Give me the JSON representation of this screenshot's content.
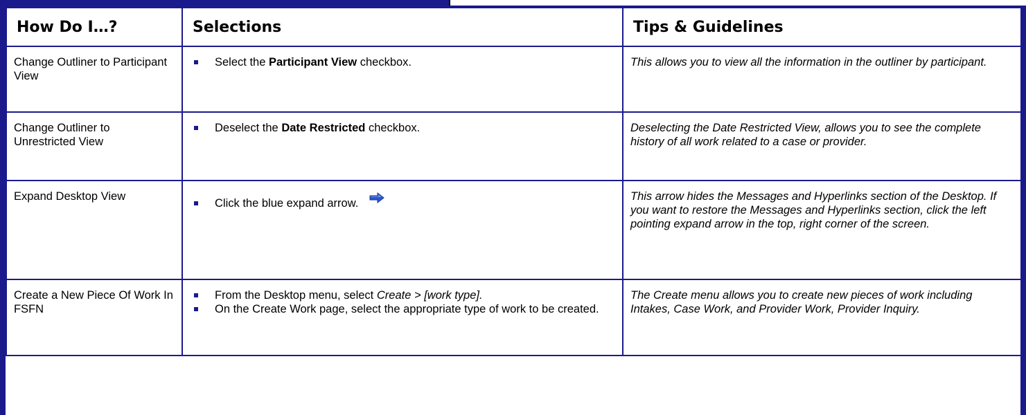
{
  "header": {
    "col1": "How Do I…?",
    "col2": "Selections",
    "col3": "Tips & Guidelines"
  },
  "rows": [
    {
      "how": "Change Outliner to Participant View",
      "sel1_pre": "Select the ",
      "sel1_bold": "Participant View",
      "sel1_post": " checkbox.",
      "tip": "This allows you to view all the information in the outliner by participant."
    },
    {
      "how": "Change Outliner to Unrestricted View",
      "sel1_pre": "Deselect the ",
      "sel1_bold": "Date Restricted",
      "sel1_post": " checkbox.",
      "tip": "Deselecting the Date Restricted View, allows you to see the complete history of all work related to a case or provider."
    },
    {
      "how": "Expand Desktop View",
      "sel1_pre": "Click the blue expand arrow.",
      "icon": "right-arrow-icon",
      "tip": "This arrow hides the Messages and Hyperlinks section of the Desktop. If you want to restore the Messages and Hyperlinks section, click the left pointing expand arrow in the top, right corner of the screen."
    },
    {
      "how": "Create a New Piece Of Work In FSFN",
      "sel1_pre": "From the Desktop menu, select ",
      "sel1_italic": "Create > [work type].",
      "sel2": "On the Create Work page, select the appropriate type of work to be created.",
      "tip": "The Create menu allows you to create new pieces of work including Intakes, Case Work, and Provider Work, Provider Inquiry."
    }
  ],
  "colors": {
    "border": "#1a1a8c",
    "bullet": "#1a1a8c",
    "arrow": "#2b56c8"
  }
}
